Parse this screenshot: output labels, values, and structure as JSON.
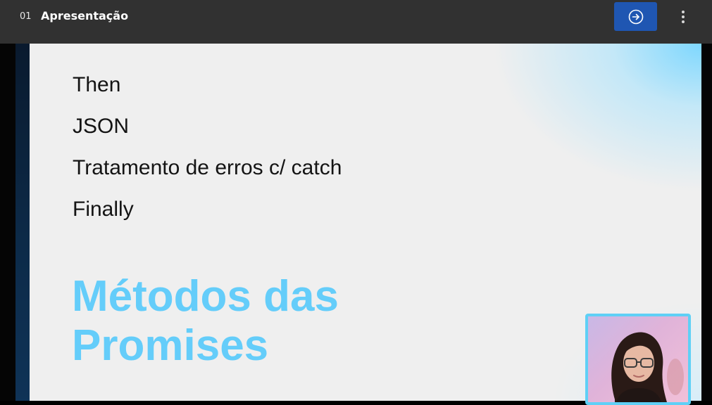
{
  "header": {
    "lesson_number": "01",
    "lesson_title": "Apresentação",
    "next_icon": "arrow-right-circle-icon",
    "menu_icon": "more-vertical-icon"
  },
  "slide": {
    "items": [
      "Then",
      "JSON",
      "Tratamento de erros c/ catch",
      "Finally"
    ],
    "heading_lines": [
      "Métodos das",
      "Promises"
    ],
    "heading_color": "#64cdfa"
  },
  "colors": {
    "topbar": "#313131",
    "accent_button": "#1f56b2",
    "webcam_border": "#5fd0f6"
  }
}
